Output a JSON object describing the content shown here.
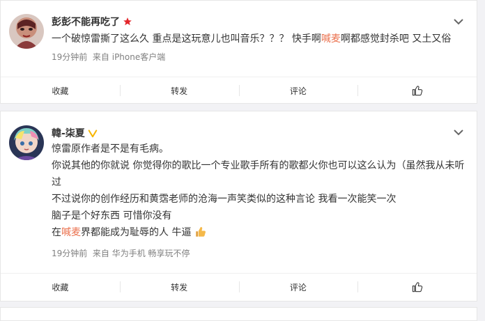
{
  "posts": [
    {
      "username": "彭彭不能再吃了",
      "text_before": "一个破惊雷撕了这么久 重点是这玩意儿也叫音乐？？？ 快手啊",
      "highlight": "喊麦",
      "text_after": "啊都感觉封杀吧 又土又俗",
      "time": "19分钟前",
      "source": "来自 iPhone客户端"
    },
    {
      "username": "韓-柒夏",
      "lines": [
        "惊雷原作者是不是有毛病。",
        "你说其他的你就说 你觉得你的歌比一个专业歌手所有的歌都火你也可以这么认为（虽然我从未听",
        "过",
        "不过说你的创作经历和黄霑老师的沧海一声笑类似的这种言论 我看一次能笑一次",
        "脑子是个好东西 可惜你没有"
      ],
      "last_line_before": "在",
      "highlight": "喊麦",
      "last_line_after": "界都能成为耻辱的人 牛逼",
      "time": "19分钟前",
      "source": "来自 华为手机 畅享玩不停"
    }
  ],
  "actions": {
    "collect": "收藏",
    "repost": "转发",
    "comment": "评论"
  },
  "colors": {
    "highlight": "#eb7350",
    "meta": "#808080",
    "star": "#e3262b",
    "verified": "#f7b500"
  }
}
